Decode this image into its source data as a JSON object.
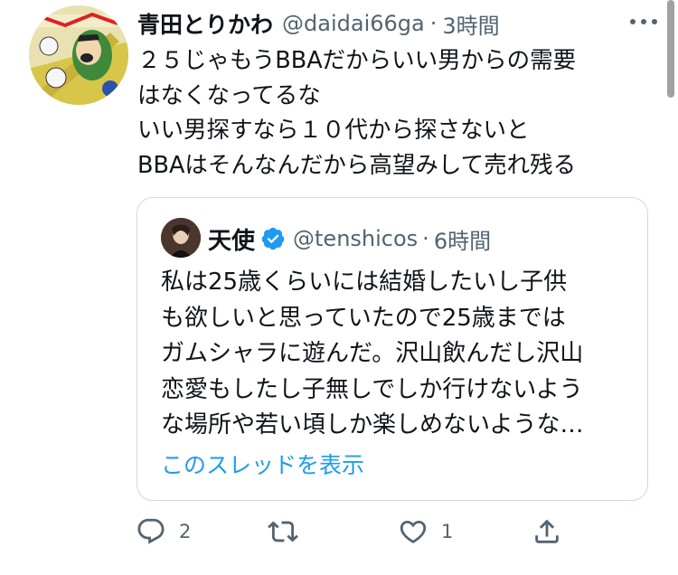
{
  "tweet": {
    "author_name": "青田とりかわ",
    "handle": "@daidai66ga",
    "separator": "·",
    "time": "3時間",
    "lines": [
      "２５じゃもうBBAだからいい男からの需要",
      "はなくなってるな",
      "いい男探すなら１０代から探さないと",
      "BBAはそんなんだから高望みして売れ残る"
    ]
  },
  "quote": {
    "author_name": "天使",
    "handle": "@tenshicos",
    "separator": "·",
    "time": "6時間",
    "lines": [
      "私は25歳くらいには結婚したいし子供",
      "も欲しいと思っていたので25歳までは",
      "ガムシャラに遊んだ。沢山飲んだし沢山",
      "恋愛もしたし子無しでしか行けないよう",
      "な場所や若い頃しか楽しめないような…"
    ],
    "show_thread": "このスレッドを表示"
  },
  "actions": {
    "reply_count": "2",
    "like_count": "1"
  },
  "icons": [
    "more-icon",
    "verified-icon",
    "reply-icon",
    "retweet-icon",
    "like-icon",
    "share-icon"
  ],
  "colors": {
    "link": "#1d9bf0",
    "muted": "#536471",
    "verified": "#1d9bf0",
    "border": "#cfd9de"
  }
}
